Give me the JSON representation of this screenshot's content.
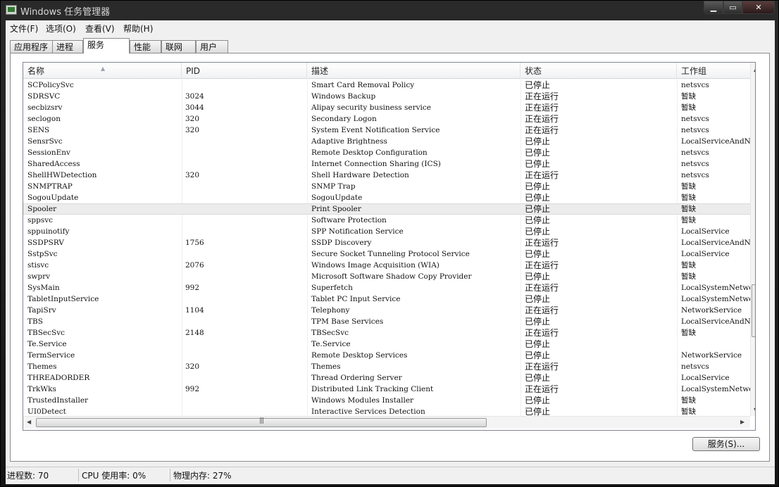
{
  "window": {
    "title": "Windows 任务管理器",
    "controls": {
      "minimize": "▁",
      "maximize": "▭",
      "close": "✕"
    }
  },
  "menu": [
    "文件(F)",
    "选项(O)",
    "查看(V)",
    "帮助(H)"
  ],
  "tabs": [
    "应用程序",
    "进程",
    "服务",
    "性能",
    "联网",
    "用户"
  ],
  "active_tab": "服务",
  "columns": {
    "name": "名称",
    "pid": "PID",
    "desc": "描述",
    "status": "状态",
    "group": "工作组"
  },
  "services": [
    {
      "name": "SCPolicySvc",
      "pid": "",
      "desc": "Smart Card Removal Policy",
      "status": "已停止",
      "group": "netsvcs"
    },
    {
      "name": "SDRSVC",
      "pid": "3024",
      "desc": "Windows Backup",
      "status": "正在运行",
      "group": "暂缺"
    },
    {
      "name": "secbizsrv",
      "pid": "3044",
      "desc": "Alipay security business service",
      "status": "正在运行",
      "group": "暂缺"
    },
    {
      "name": "seclogon",
      "pid": "320",
      "desc": "Secondary Logon",
      "status": "正在运行",
      "group": "netsvcs"
    },
    {
      "name": "SENS",
      "pid": "320",
      "desc": "System Event Notification Service",
      "status": "正在运行",
      "group": "netsvcs"
    },
    {
      "name": "SensrSvc",
      "pid": "",
      "desc": "Adaptive Brightness",
      "status": "已停止",
      "group": "LocalServiceAndN"
    },
    {
      "name": "SessionEnv",
      "pid": "",
      "desc": "Remote Desktop Configuration",
      "status": "已停止",
      "group": "netsvcs"
    },
    {
      "name": "SharedAccess",
      "pid": "",
      "desc": "Internet Connection Sharing (ICS)",
      "status": "已停止",
      "group": "netsvcs"
    },
    {
      "name": "ShellHWDetection",
      "pid": "320",
      "desc": "Shell Hardware Detection",
      "status": "正在运行",
      "group": "netsvcs"
    },
    {
      "name": "SNMPTRAP",
      "pid": "",
      "desc": "SNMP Trap",
      "status": "已停止",
      "group": "暂缺"
    },
    {
      "name": "SogouUpdate",
      "pid": "",
      "desc": "SogouUpdate",
      "status": "已停止",
      "group": "暂缺"
    },
    {
      "name": "Spooler",
      "pid": "",
      "desc": "Print Spooler",
      "status": "已停止",
      "group": "暂缺",
      "selected": true
    },
    {
      "name": "sppsvc",
      "pid": "",
      "desc": "Software Protection",
      "status": "已停止",
      "group": "暂缺"
    },
    {
      "name": "sppuinotify",
      "pid": "",
      "desc": "SPP Notification Service",
      "status": "已停止",
      "group": "LocalService"
    },
    {
      "name": "SSDPSRV",
      "pid": "1756",
      "desc": "SSDP Discovery",
      "status": "正在运行",
      "group": "LocalServiceAndN"
    },
    {
      "name": "SstpSvc",
      "pid": "",
      "desc": "Secure Socket Tunneling Protocol Service",
      "status": "已停止",
      "group": "LocalService"
    },
    {
      "name": "stisvc",
      "pid": "2076",
      "desc": "Windows Image Acquisition (WIA)",
      "status": "正在运行",
      "group": "暂缺"
    },
    {
      "name": "swprv",
      "pid": "",
      "desc": "Microsoft Software Shadow Copy Provider",
      "status": "已停止",
      "group": "暂缺"
    },
    {
      "name": "SysMain",
      "pid": "992",
      "desc": "Superfetch",
      "status": "正在运行",
      "group": "LocalSystemNetwo"
    },
    {
      "name": "TabletInputService",
      "pid": "",
      "desc": "Tablet PC Input Service",
      "status": "已停止",
      "group": "LocalSystemNetwo"
    },
    {
      "name": "TapiSrv",
      "pid": "1104",
      "desc": "Telephony",
      "status": "正在运行",
      "group": "NetworkService"
    },
    {
      "name": "TBS",
      "pid": "",
      "desc": "TPM Base Services",
      "status": "已停止",
      "group": "LocalServiceAndN"
    },
    {
      "name": "TBSecSvc",
      "pid": "2148",
      "desc": "TBSecSvc",
      "status": "正在运行",
      "group": "暂缺"
    },
    {
      "name": "Te.Service",
      "pid": "",
      "desc": "Te.Service",
      "status": "已停止",
      "group": ""
    },
    {
      "name": "TermService",
      "pid": "",
      "desc": "Remote Desktop Services",
      "status": "已停止",
      "group": "NetworkService"
    },
    {
      "name": "Themes",
      "pid": "320",
      "desc": "Themes",
      "status": "正在运行",
      "group": "netsvcs"
    },
    {
      "name": "THREADORDER",
      "pid": "",
      "desc": "Thread Ordering Server",
      "status": "已停止",
      "group": "LocalService"
    },
    {
      "name": "TrkWks",
      "pid": "992",
      "desc": "Distributed Link Tracking Client",
      "status": "正在运行",
      "group": "LocalSystemNetwo"
    },
    {
      "name": "TrustedInstaller",
      "pid": "",
      "desc": "Windows Modules Installer",
      "status": "已停止",
      "group": "暂缺"
    },
    {
      "name": "UI0Detect",
      "pid": "",
      "desc": "Interactive Services Detection",
      "status": "已停止",
      "group": "暂缺"
    }
  ],
  "services_button": "服务(S)...",
  "statusbar": {
    "processes": "进程数: 70",
    "cpu": "CPU 使用率: 0%",
    "memory": "物理内存: 27%"
  }
}
